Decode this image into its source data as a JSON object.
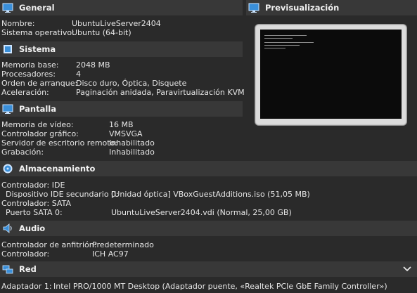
{
  "general": {
    "title": "General",
    "rows": [
      {
        "key": "Nombre:",
        "value": "UbuntuLiveServer2404"
      },
      {
        "key": "Sistema operativo:",
        "value": "Ubuntu (64-bit)"
      }
    ]
  },
  "preview": {
    "title": "Previsualización"
  },
  "sistema": {
    "title": "Sistema",
    "rows": [
      {
        "key": "Memoria base:",
        "value": "2048 MB"
      },
      {
        "key": "Procesadores:",
        "value": "4"
      },
      {
        "key": "Orden de arranque:",
        "value": "Disco duro, Óptica, Disquete"
      },
      {
        "key": "Aceleración:",
        "value": "Paginación anidada, Paravirtualización KVM"
      }
    ]
  },
  "pantalla": {
    "title": "Pantalla",
    "rows": [
      {
        "key": "Memoria de vídeo:",
        "value": "16 MB"
      },
      {
        "key": "Controlador gráfico:",
        "value": "VMSVGA"
      },
      {
        "key": "Servidor de escritorio remoto:",
        "value": "Inhabilitado"
      },
      {
        "key": "Grabación:",
        "value": "Inhabilitado"
      }
    ]
  },
  "almacenamiento": {
    "title": "Almacenamiento",
    "rows": [
      {
        "key": "Controlador: IDE",
        "value": ""
      },
      {
        "key": "Dispositivo IDE secundario 0:",
        "value": "[Unidad óptica] VBoxGuestAdditions.iso (51,05 MB)"
      },
      {
        "key": "Controlador: SATA",
        "value": ""
      },
      {
        "key": "Puerto SATA 0:",
        "value": "UbuntuLiveServer2404.vdi (Normal, 25,00 GB)"
      }
    ]
  },
  "audio": {
    "title": "Audio",
    "rows": [
      {
        "key": "Controlador de anfitrión:",
        "value": "Predeterminado"
      },
      {
        "key": "Controlador:",
        "value": "ICH AC97"
      }
    ]
  },
  "red": {
    "title": "Red",
    "rows": [
      {
        "key": "Adaptador 1:",
        "value": "Intel PRO/1000 MT Desktop (Adaptador puente, «Realtek PCIe GbE Family Controller»)"
      }
    ]
  },
  "icons": {
    "general": "monitor-icon",
    "sistema": "chip-icon",
    "pantalla": "monitor-icon",
    "almacenamiento": "disk-icon",
    "audio": "speaker-icon",
    "red": "network-icon",
    "preview": "monitor-icon",
    "collapse": "chevron-down-icon"
  },
  "colors": {
    "background": "#2a2a2a",
    "header": "#383838",
    "accent_blue": "#3a8fd9"
  }
}
